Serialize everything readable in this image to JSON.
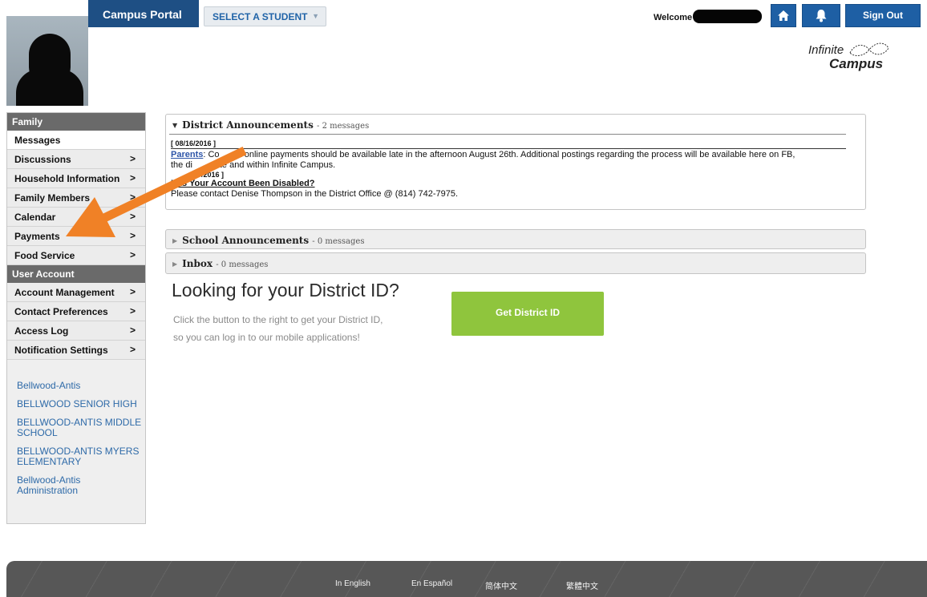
{
  "header": {
    "app_title": "Campus Portal",
    "select_student_label": "SELECT A STUDENT",
    "welcome_label": "Welcome",
    "sign_out_label": "Sign Out",
    "logo_line1": "Infinite",
    "logo_line2": "Campus",
    "accent_color": "#1e5fa4"
  },
  "sidebar": {
    "family_header": "Family",
    "family_items": [
      {
        "label": "Messages",
        "active": true,
        "chevron": ""
      },
      {
        "label": "Discussions",
        "chevron": ">"
      },
      {
        "label": "Household Information",
        "chevron": ">"
      },
      {
        "label": "Family Members",
        "chevron": ">"
      },
      {
        "label": "Calendar",
        "chevron": ">"
      },
      {
        "label": "Payments",
        "chevron": ">"
      },
      {
        "label": "Food Service",
        "chevron": ">"
      }
    ],
    "account_header": "User Account",
    "account_items": [
      {
        "label": "Account Management",
        "chevron": ">"
      },
      {
        "label": "Contact Preferences",
        "chevron": ">"
      },
      {
        "label": "Access Log",
        "chevron": ">"
      },
      {
        "label": "Notification Settings",
        "chevron": ">"
      }
    ],
    "links": [
      "Bellwood-Antis",
      "BELLWOOD SENIOR HIGH",
      "BELLWOOD-ANTIS MIDDLE SCHOOL",
      "BELLWOOD-ANTIS MYERS ELEMENTARY",
      "Bellwood-Antis Administration"
    ]
  },
  "district_announcements": {
    "title": "District Announcements",
    "count": "- 2 messages",
    "message1": {
      "date": "[ 08/16/2016 ]",
      "link": "Parents",
      "text_a": ": Co",
      "text_b": "a online payments should be available late in the afternoon August 26th. Additional postings regarding the process will be available here on FB,",
      "text_c": "the di",
      "text_d": "site and within Infinite Campus."
    },
    "message2": {
      "date": "/2016 ]",
      "title": "Has Your Account Been Disabled?",
      "text": "Please contact Denise Thompson in the District Office @ (814) 742-7975."
    }
  },
  "school_announcements": {
    "title": "School Announcements",
    "count": "- 0 messages"
  },
  "inbox": {
    "title": "Inbox",
    "count": "- 0 messages"
  },
  "district_id": {
    "heading": "Looking for your District ID?",
    "line1": "Click the button to the right to get your District ID,",
    "line2": "so you can log in to our mobile applications!",
    "button": "Get District ID",
    "button_color": "#8fc53d"
  },
  "footer": {
    "languages": [
      "In English",
      "En Español",
      "简体中文",
      "繁體中文"
    ]
  },
  "annotation": {
    "arrow_color": "#f08126"
  }
}
